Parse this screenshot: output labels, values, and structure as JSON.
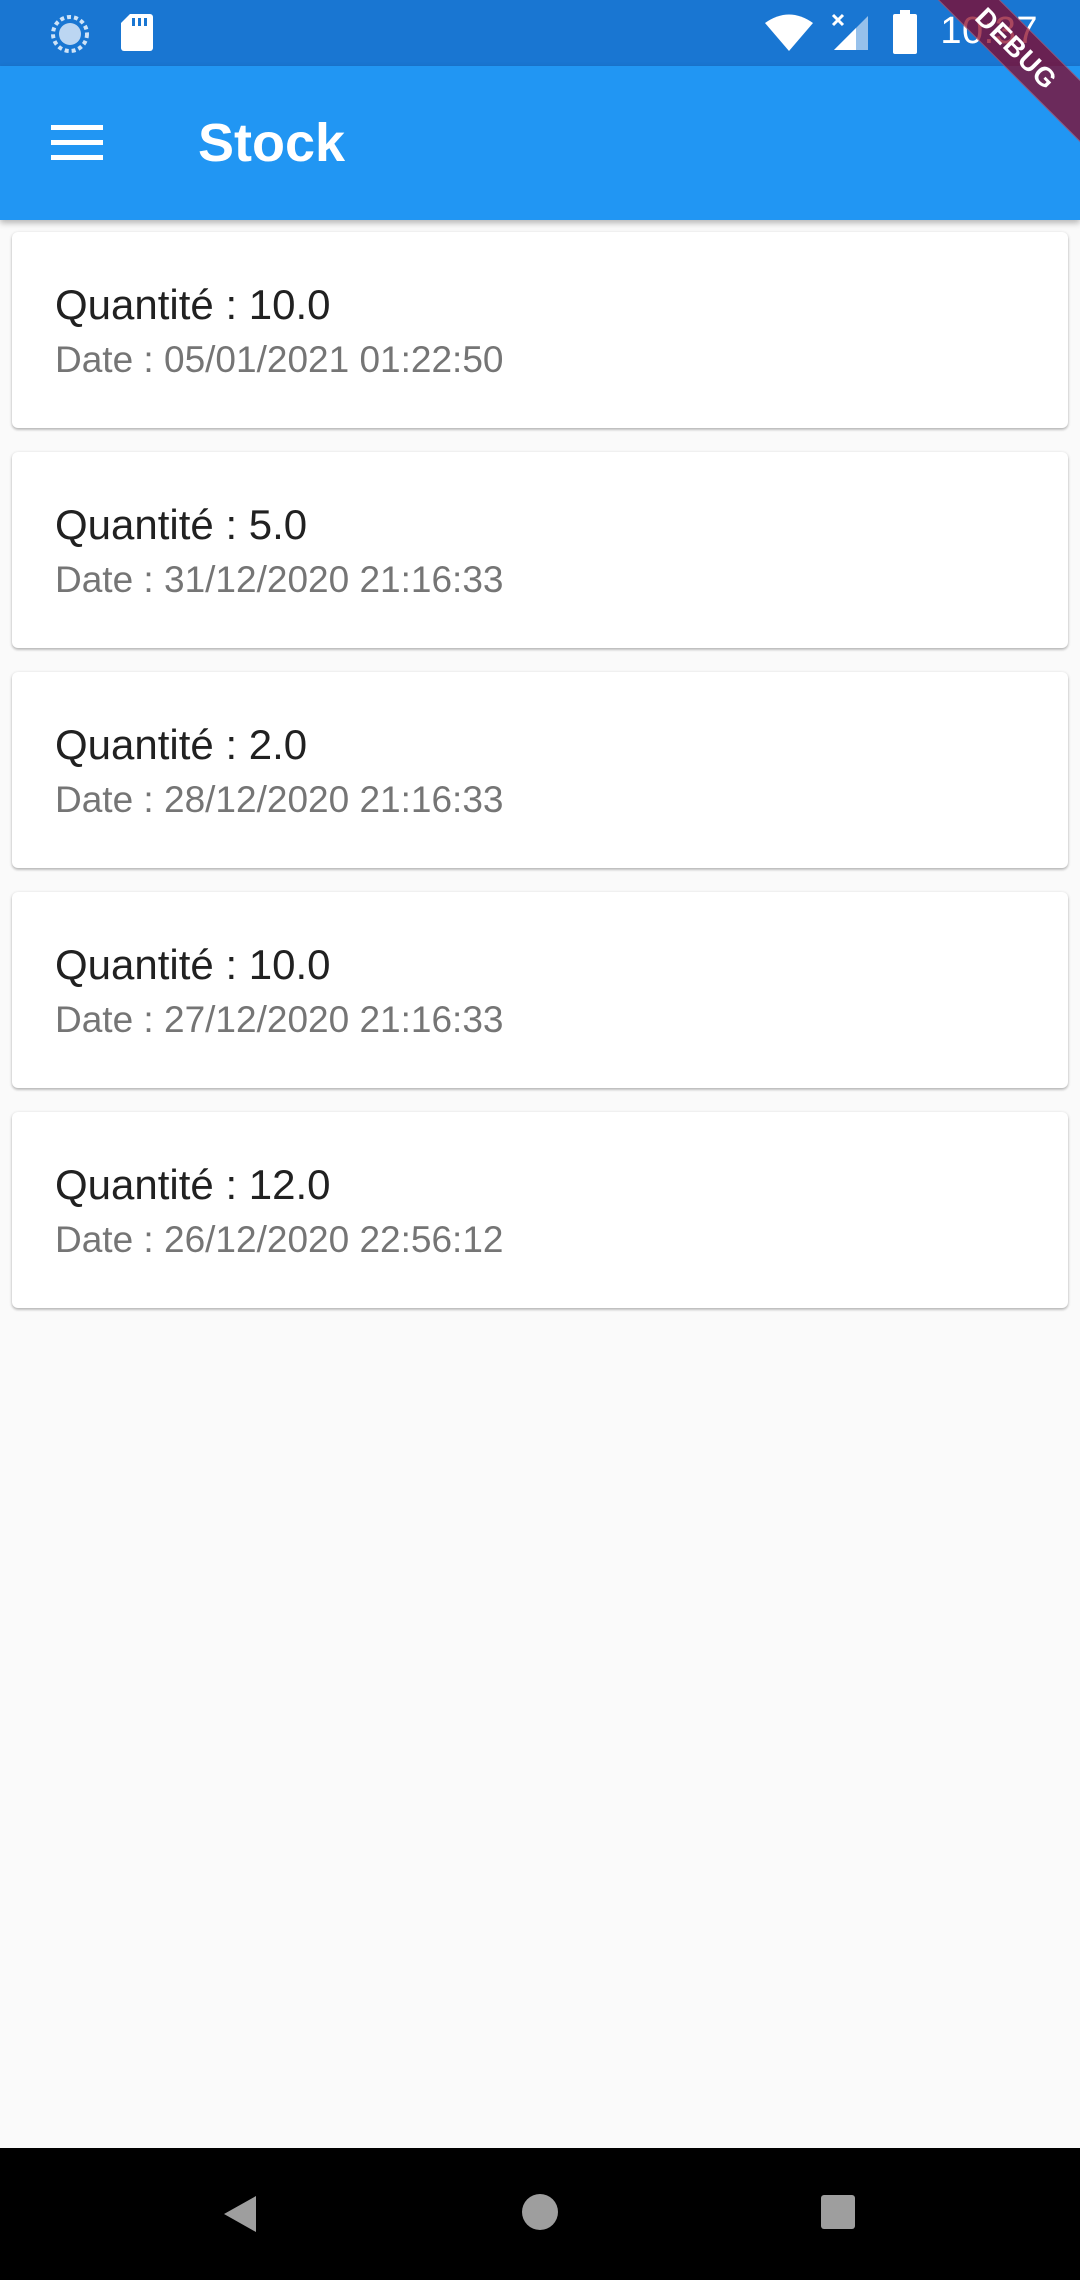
{
  "status_bar": {
    "time": "10:37",
    "icons": [
      "sync-icon",
      "sd-card-icon",
      "wifi-icon",
      "cell-signal-icon",
      "battery-icon"
    ]
  },
  "app_bar": {
    "title": "Stock",
    "menu_icon": "hamburger-menu-icon",
    "background": "#2196f3",
    "status_background": "#1976d2"
  },
  "debug_banner": "DEBUG",
  "stock_entries": [
    {
      "quantity": "Quantité : 10.0",
      "date": "Date : 05/01/2021 01:22:50"
    },
    {
      "quantity": "Quantité : 5.0",
      "date": "Date : 31/12/2020 21:16:33"
    },
    {
      "quantity": "Quantité : 2.0",
      "date": "Date : 28/12/2020 21:16:33"
    },
    {
      "quantity": "Quantité : 10.0",
      "date": "Date : 27/12/2020 21:16:33"
    },
    {
      "quantity": "Quantité : 12.0",
      "date": "Date : 26/12/2020 22:56:12"
    }
  ],
  "nav_bar": {
    "icons": [
      "back-icon",
      "home-icon",
      "recents-icon"
    ]
  }
}
